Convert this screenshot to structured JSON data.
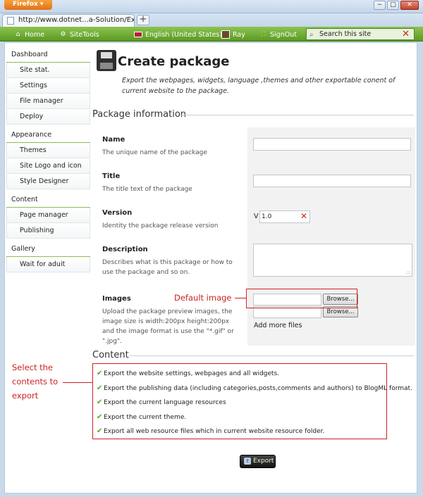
{
  "browser": {
    "app_button": "Firefox",
    "tab_title": "http://www.dotnet...a-Solution/Export",
    "new_tab": "+",
    "minimize": "−",
    "maximize": "□",
    "close": "✕"
  },
  "navbar": {
    "home": "Home",
    "sitetools": "SiteTools",
    "language": "English (United States)",
    "user": "Ray",
    "signout": "SignOut",
    "search_placeholder": "Search this site"
  },
  "sidebar": {
    "groups": [
      {
        "title": "Dashboard",
        "items": [
          "Site stat.",
          "Settings",
          "File manager",
          "Deploy"
        ]
      },
      {
        "title": "Appearance",
        "items": [
          "Themes",
          "Site Logo and icon",
          "Style Designer"
        ]
      },
      {
        "title": "Content",
        "items": [
          "Page manager",
          "Publishing"
        ]
      },
      {
        "title": "Gallery",
        "items": [
          "Wait for aduit"
        ]
      }
    ]
  },
  "page": {
    "title": "Create package",
    "description": "Export the webpages, widgets, language ,themes and other exportable conent of current website to the package."
  },
  "package_info": {
    "section_title": "Package information",
    "fields": {
      "name": {
        "label": "Name",
        "hint": "The unique name of the package"
      },
      "title": {
        "label": "Title",
        "hint": "The title text of the package"
      },
      "version": {
        "label": "Version",
        "hint": "Identity the package release version",
        "prefix": "V",
        "value": "1.0"
      },
      "description": {
        "label": "Description",
        "hint": "Describes what is this package or how to use the package and so on."
      },
      "images": {
        "label": "Images",
        "hint": "Upload the package preview images, the image size is width:200px height:200px and the image format is use the \"*.gif\" or \".jpg\"."
      }
    },
    "browse_label": "Browse...",
    "add_more": "Add more files"
  },
  "annotations": {
    "default_image": "Default image",
    "select_contents": [
      "Select the",
      "contents to",
      "export"
    ]
  },
  "content_section": {
    "title": "Content",
    "items": [
      "Export the website settings, webpages and all widgets.",
      "Export the publishing data (including categories,posts,comments and authors) to BlogML format.",
      "Export the current language resources",
      "Export the current theme.",
      "Export all web resource files which in current website resource folder."
    ]
  },
  "export_button": "Export",
  "colors": {
    "nav_green": "#5a9a22",
    "check_green": "#58a51e",
    "annotation_red": "#cc2222",
    "remove_red": "#c62b1b"
  },
  "icons": {
    "home": "home-icon",
    "sitetools": "tools-icon",
    "language": "flag-icon",
    "user": "avatar-icon",
    "signout": "signout-icon",
    "search": "search-icon",
    "clear": "close-icon",
    "page": "disk-icon",
    "check": "check-icon",
    "export": "export-icon"
  }
}
